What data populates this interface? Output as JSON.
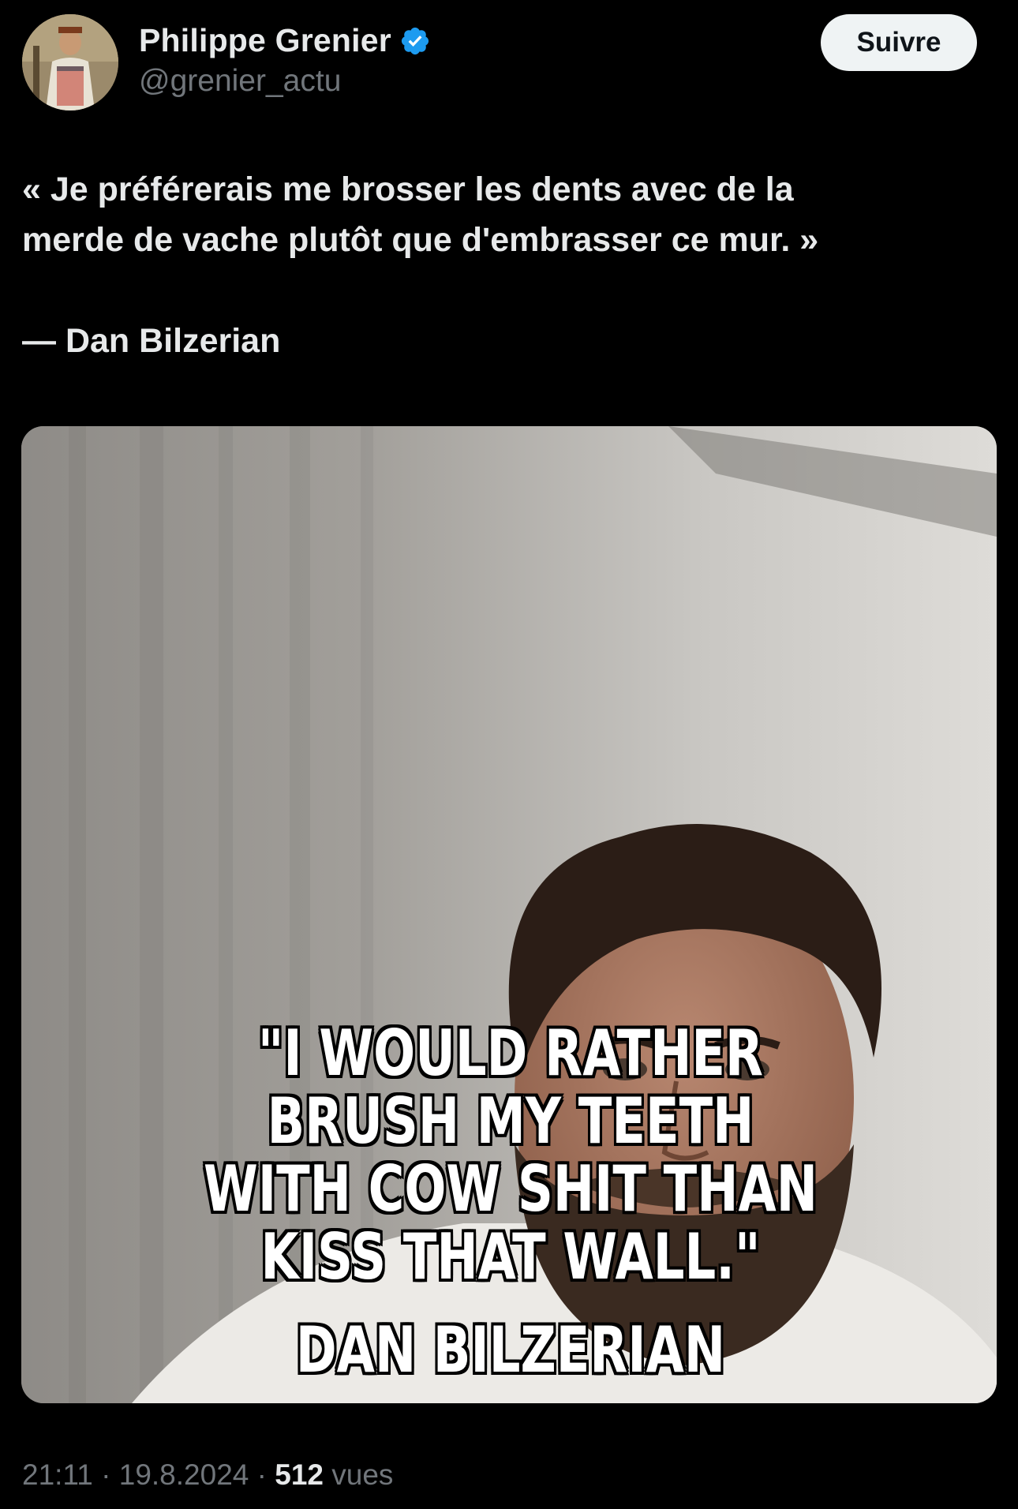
{
  "author": {
    "display_name": "Philippe Grenier",
    "handle": "@grenier_actu",
    "verified_icon": "verified-badge-icon",
    "avatar_icon": "avatar-image"
  },
  "follow_button": {
    "label": "Suivre"
  },
  "tweet": {
    "line1": "« Je préférerais me brosser les dents avec de la",
    "line2": "merde de vache plutôt que d'embrasser ce mur. »",
    "attribution": "— Dan Bilzerian"
  },
  "media": {
    "caption_quote": "\"I WOULD RATHER BRUSH MY TEETH WITH COW SHIT THAN KISS THAT WALL.\"",
    "caption_author": "DAN BILZERIAN"
  },
  "meta": {
    "time": "21:11",
    "separator1": " · ",
    "date": "19.8.2024",
    "separator2": " · ",
    "views_count": "512",
    "views_label": " vues"
  },
  "colors": {
    "background": "#000000",
    "text_primary": "#e7e9ea",
    "text_secondary": "#71767b",
    "verified_blue": "#1d9bf0",
    "button_bg": "#eff3f4"
  }
}
